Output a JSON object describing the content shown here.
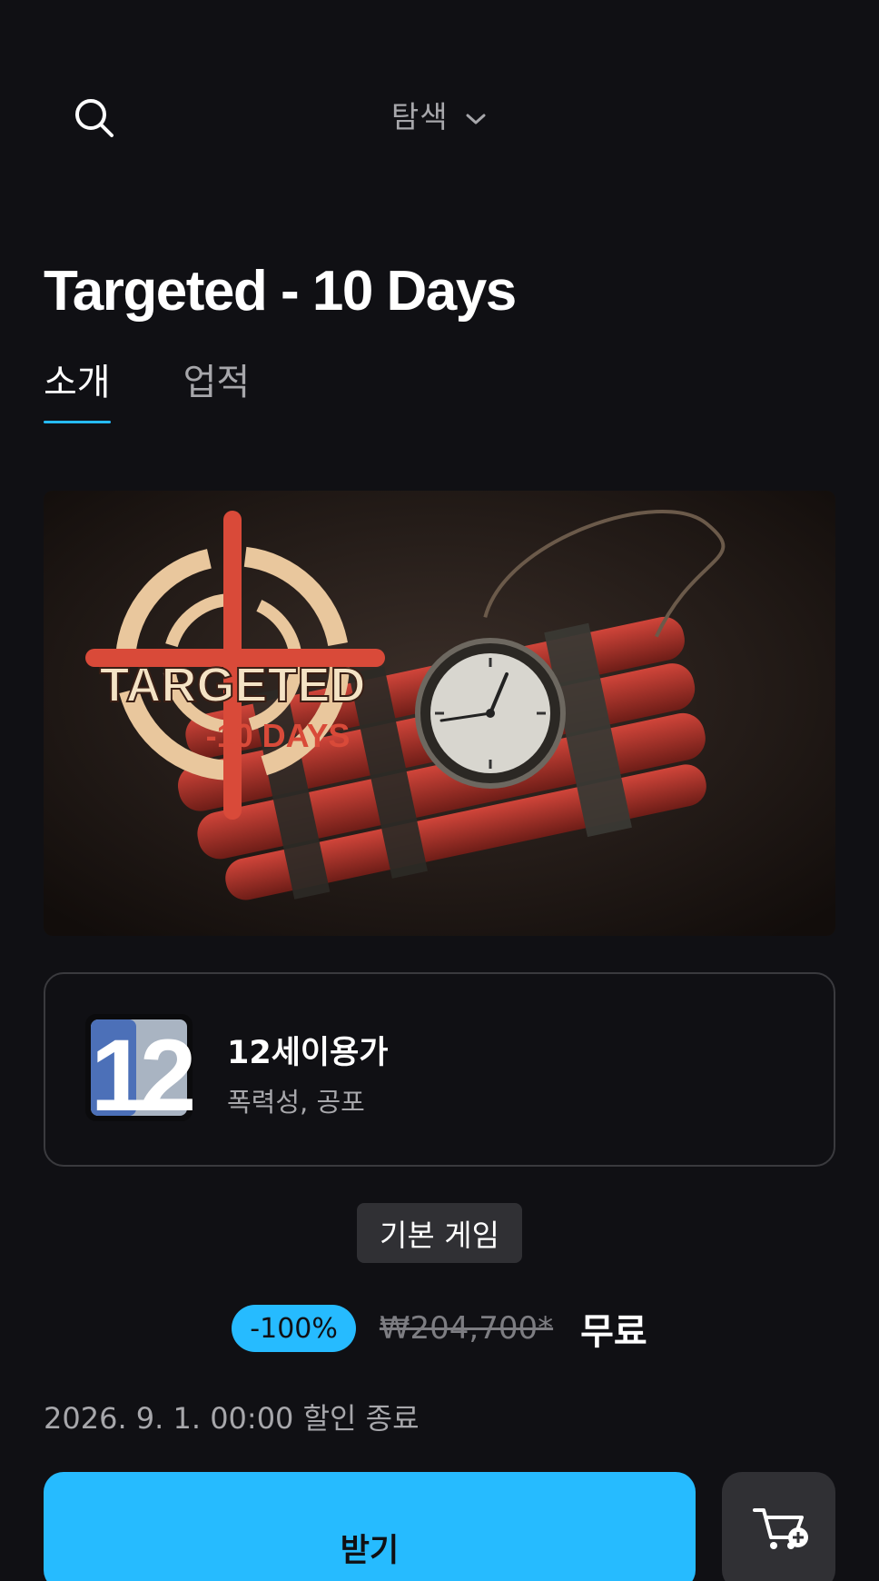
{
  "header": {
    "browse_label": "탐색",
    "icons": {
      "search": "search-icon",
      "chevron": "chevron-down-icon"
    }
  },
  "product": {
    "title": "Targeted - 10 Days",
    "hero_logo_line1": "TARGETED",
    "hero_logo_line2": "-10 DAYS"
  },
  "tabs": [
    {
      "label": "소개",
      "active": true
    },
    {
      "label": "업적",
      "active": false
    }
  ],
  "rating": {
    "icon_number": "12",
    "title": "12세이용가",
    "descriptors": "폭력성, 공포"
  },
  "edition_badge": "기본 게임",
  "price": {
    "discount": "-100%",
    "original": "₩204,700*",
    "final": "무료"
  },
  "sale_end": "2026. 9. 1. 00:00 할인 종료",
  "actions": {
    "get_label": "받기",
    "cart_icon": "cart-add-icon"
  },
  "colors": {
    "background": "#101014",
    "accent": "#26bbff",
    "secondary_text": "#a7a7ab",
    "surface": "#303034"
  }
}
